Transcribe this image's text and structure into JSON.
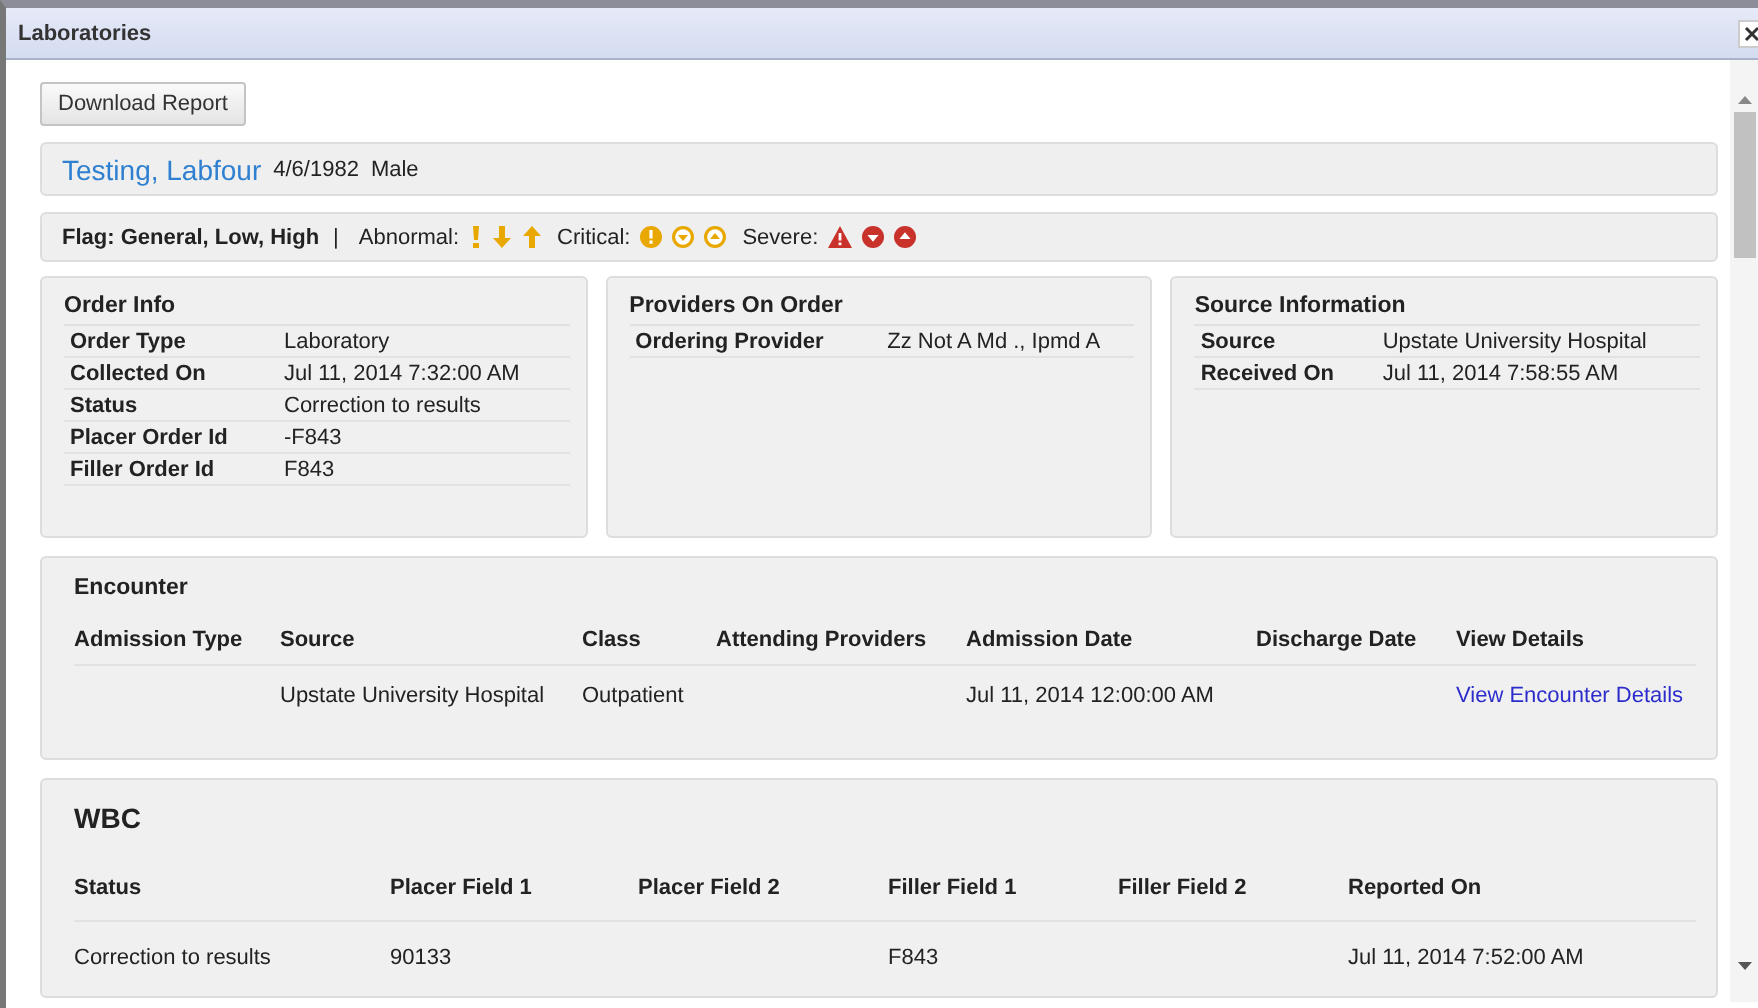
{
  "window": {
    "title": "Laboratories"
  },
  "download_button": "Download Report",
  "patient": {
    "name": "Testing, Labfour",
    "dob": "4/6/1982",
    "sex": "Male"
  },
  "flag_legend": {
    "title": "Flag: General, Low, High",
    "separator": "|",
    "groups": [
      {
        "label": "Abnormal:",
        "kind": "abnormal"
      },
      {
        "label": "Critical:",
        "kind": "critical"
      },
      {
        "label": "Severe:",
        "kind": "severe"
      }
    ]
  },
  "panels": [
    {
      "title": "Order Info",
      "rows": [
        {
          "label": "Order Type",
          "value": "Laboratory"
        },
        {
          "label": "Collected On",
          "value": "Jul 11, 2014 7:32:00 AM"
        },
        {
          "label": "Status",
          "value": "Correction to results"
        },
        {
          "label": "Placer Order Id",
          "value": "-F843"
        },
        {
          "label": "Filler Order Id",
          "value": "F843"
        }
      ]
    },
    {
      "title": "Providers On Order",
      "rows": [
        {
          "label": "Ordering Provider",
          "value": "Zz Not A Md ., Ipmd A"
        }
      ]
    },
    {
      "title": "Source Information",
      "rows": [
        {
          "label": "Source",
          "value": "Upstate University Hospital"
        },
        {
          "label": "Received On",
          "value": "Jul 11, 2014 7:58:55 AM"
        }
      ]
    }
  ],
  "encounter": {
    "title": "Encounter",
    "columns": [
      "Admission Type",
      "Source",
      "Class",
      "Attending Providers",
      "Admission Date",
      "Discharge Date",
      "View Details"
    ],
    "rows": [
      {
        "cells": [
          {
            "text": ""
          },
          {
            "text": "Upstate University Hospital"
          },
          {
            "text": "Outpatient"
          },
          {
            "text": ""
          },
          {
            "text": "Jul 11, 2014 12:00:00 AM"
          },
          {
            "text": ""
          },
          {
            "text": "View Encounter Details",
            "kind": "link"
          }
        ]
      }
    ]
  },
  "result": {
    "title": "WBC",
    "columns": [
      "Status",
      "Placer Field 1",
      "Placer Field 2",
      "Filler Field 1",
      "Filler Field 2",
      "Reported On"
    ],
    "rows": [
      {
        "cells": [
          "Correction to results",
          "90133",
          "",
          "F843",
          "",
          "Jul 11, 2014 7:52:00 AM"
        ]
      }
    ]
  }
}
